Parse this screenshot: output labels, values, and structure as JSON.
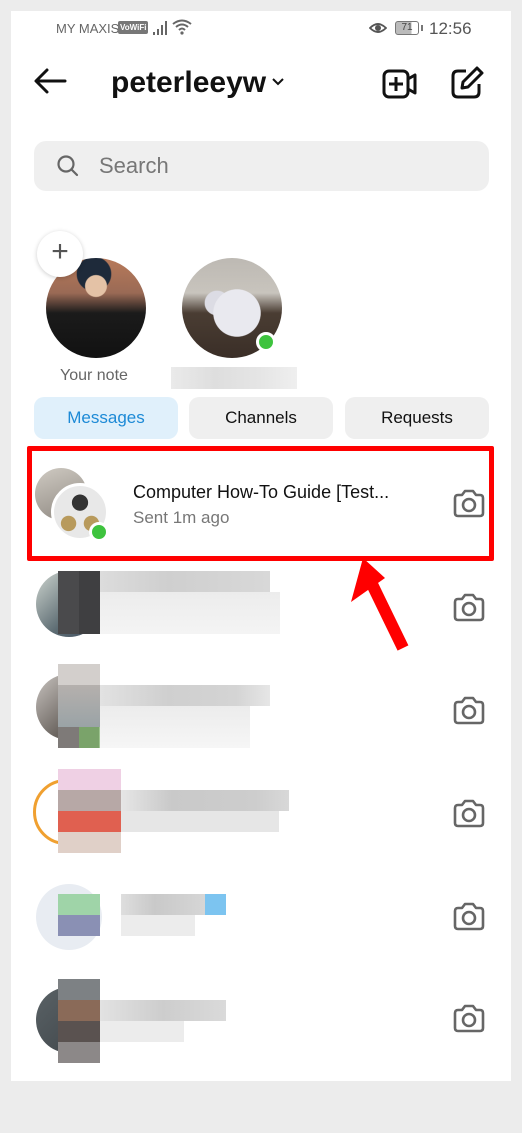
{
  "status_bar": {
    "carrier": "MY MAXIS",
    "vowifi_badge": "VoWiFi",
    "battery_level": "71",
    "time": "12:56"
  },
  "header": {
    "back_icon": "arrow-left-icon",
    "username": "peterleeyw",
    "dropdown_icon": "chevron-down-icon",
    "video_icon": "new-video-call-icon",
    "compose_icon": "compose-message-icon"
  },
  "search": {
    "placeholder": "Search",
    "value": ""
  },
  "notes": {
    "add_icon": "plus-icon",
    "items": [
      {
        "label": "Your note",
        "online": false
      },
      {
        "label": "",
        "label_obscured": true,
        "online": true
      }
    ]
  },
  "tabs": [
    {
      "label": "Messages",
      "active": true
    },
    {
      "label": "Channels",
      "active": false
    },
    {
      "label": "Requests",
      "active": false
    }
  ],
  "threads": [
    {
      "name": "Computer How-To Guide [Test...",
      "subtitle": "Sent 1m ago",
      "online": true,
      "highlighted": true,
      "action_icon": "camera-icon"
    },
    {
      "name": "",
      "subtitle": "",
      "obscured": true,
      "action_icon": "camera-icon"
    },
    {
      "name": "",
      "subtitle": "",
      "obscured": true,
      "action_icon": "camera-icon"
    },
    {
      "name": "",
      "subtitle": "",
      "obscured": true,
      "action_icon": "camera-icon"
    },
    {
      "name": "",
      "subtitle": "",
      "obscured": true,
      "action_icon": "camera-icon"
    },
    {
      "name": "",
      "subtitle": "",
      "obscured": true,
      "action_icon": "camera-icon"
    }
  ],
  "annotation": {
    "highlight_color": "#ff0000",
    "arrow_color": "#ff0000"
  },
  "nav_bar": {
    "back": "nav-back-icon",
    "home": "nav-home-icon",
    "recents": "nav-recents-icon"
  },
  "colors": {
    "accent": "#1d8ad6",
    "active_tab_bg": "#e0f0fb",
    "online": "#3ec33e"
  }
}
